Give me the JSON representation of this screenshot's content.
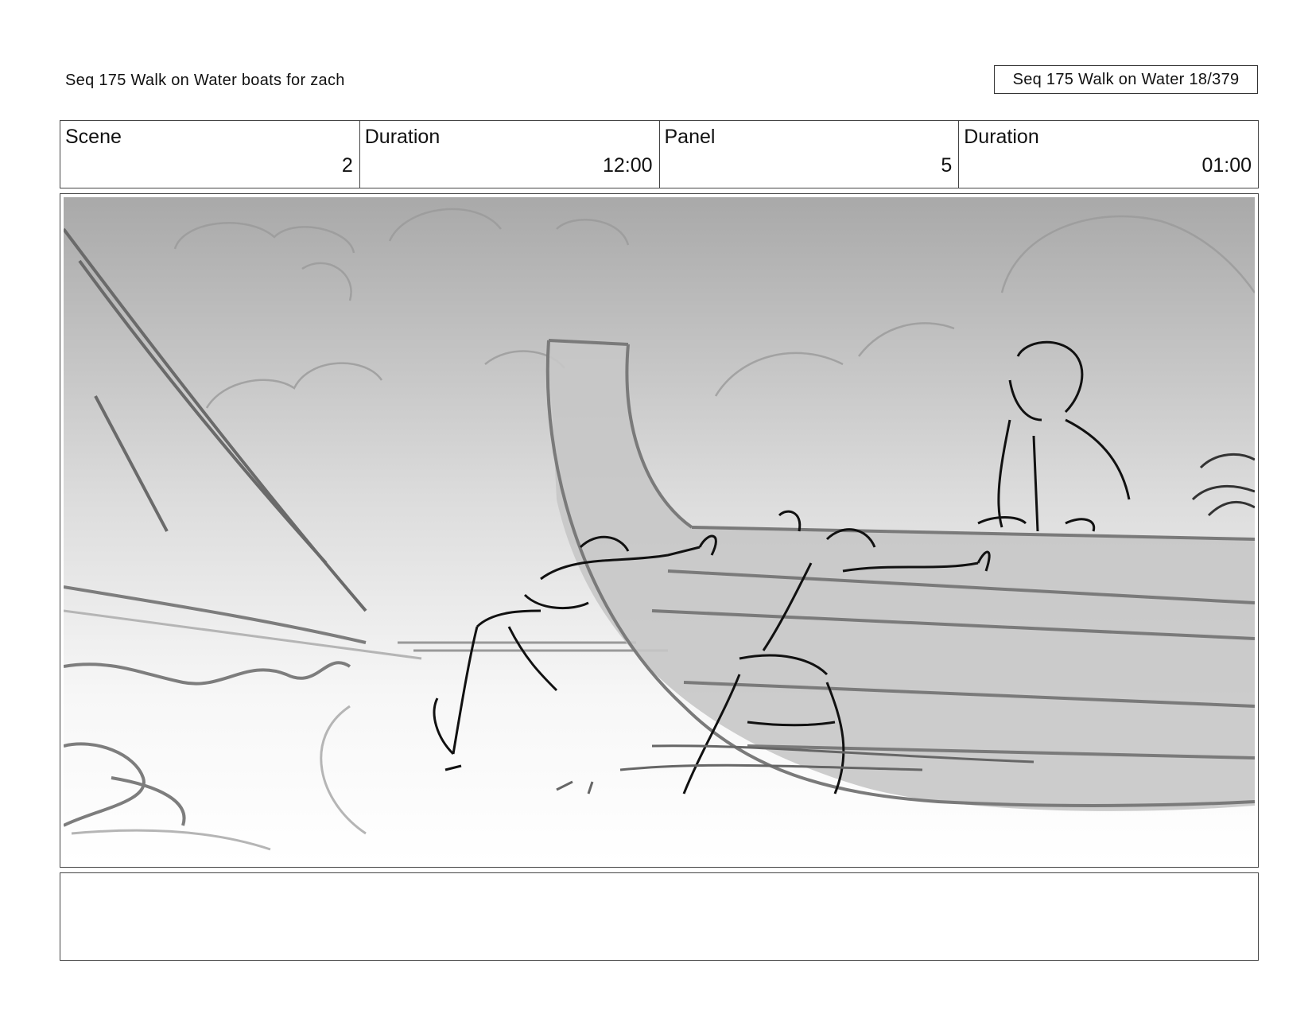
{
  "header": {
    "title": "Seq 175 Walk on Water  boats for zach",
    "page_counter": "Seq 175 Walk on Water  18/379"
  },
  "info": {
    "scene_label": "Scene",
    "scene_value": "2",
    "scene_duration_label": "Duration",
    "scene_duration_value": "12:00",
    "panel_label": "Panel",
    "panel_value": "5",
    "panel_duration_label": "Duration",
    "panel_duration_value": "01:00"
  },
  "notes": {
    "text": ""
  }
}
